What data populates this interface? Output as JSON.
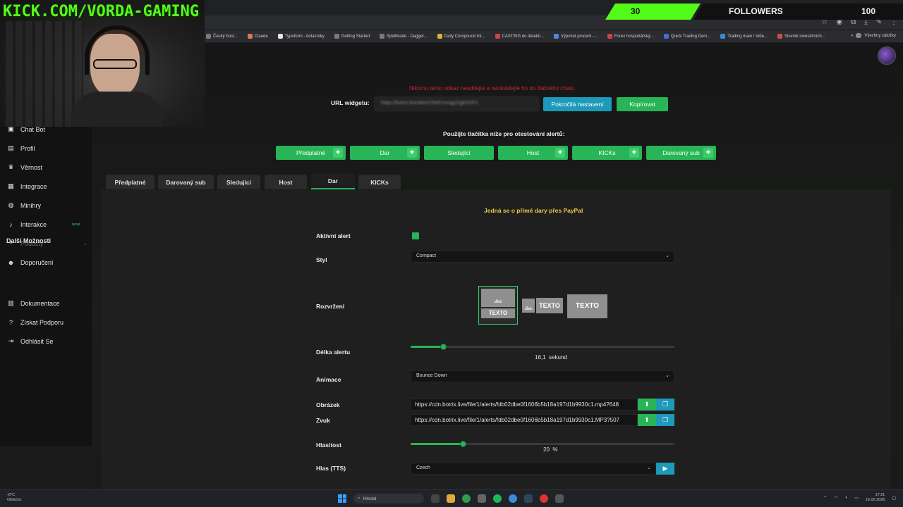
{
  "overlay": {
    "channel_title": "KICK.COM/VORDA-GAMING",
    "follower_count": "30",
    "follower_label": "FOLLOWERS",
    "follower_goal": "100"
  },
  "browser": {
    "bookmarks": [
      {
        "label": "Český host...",
        "icon": "globe-icon"
      },
      {
        "label": "Claude",
        "icon": "claude-icon"
      },
      {
        "label": "Typeform - dotazníky",
        "icon": "typeform-icon"
      },
      {
        "label": "Getting Started",
        "icon": "bookmark-icon"
      },
      {
        "label": "Spellblade - Dagger...",
        "icon": "bookmark-icon"
      },
      {
        "label": "Daily Compound Int...",
        "icon": "folder-icon"
      },
      {
        "label": "CASTING do detekti...",
        "icon": "bookmark-icon"
      },
      {
        "label": "Výpočet procent -...",
        "icon": "bookmark-icon"
      },
      {
        "label": "Forex hospodářský...",
        "icon": "bookmark-icon"
      },
      {
        "label": "Quick Trading Dem...",
        "icon": "bookmark-icon"
      },
      {
        "label": "Trading main / Vide...",
        "icon": "bookmark-icon"
      },
      {
        "label": "Slovník investičních...",
        "icon": "bookmark-icon"
      }
    ],
    "all_bookmarks": "Všechny záložky"
  },
  "sidebar": {
    "items": [
      {
        "label": "Chat Bot",
        "icon": "robot-icon"
      },
      {
        "label": "Profil",
        "icon": "id-card-icon"
      },
      {
        "label": "Věrnost",
        "icon": "trophy-icon"
      },
      {
        "label": "Integrace",
        "icon": "puzzle-icon"
      },
      {
        "label": "Minihry",
        "icon": "gamepad-icon"
      },
      {
        "label": "Interakce",
        "icon": "music-icon",
        "badge": "nové"
      },
      {
        "label": "Podúčty",
        "icon": "user-gear-icon"
      },
      {
        "label": "Doporučení",
        "icon": "users-icon"
      }
    ],
    "section_heading": "Další Možnosti",
    "more_items": [
      {
        "label": "Dokumentace",
        "icon": "book-icon"
      },
      {
        "label": "Získat Podporu",
        "icon": "question-icon"
      },
      {
        "label": "Odhlásit Se",
        "icon": "logout-icon"
      }
    ]
  },
  "widget": {
    "warning": "Nikomu tento odkaz nesdílejte a neukládejte ho do žádného chatu",
    "url_label": "URL widgetu:",
    "url_value": "https://botrix.live/alerts?bid=mvqg22gk%2F2",
    "advanced_button": "Pokročilá nastavení",
    "copy_button": "Kopírovat",
    "test_hint": "Použijte tlačítka níže pro otestování alertů:",
    "test_buttons": [
      "Předplatné",
      "Dar",
      "Sledující",
      "Host",
      "KICKs",
      "Darovaný sub"
    ]
  },
  "tabs": [
    "Předplatné",
    "Darovaný sub",
    "Sledující",
    "Host",
    "Dar",
    "KICKs"
  ],
  "active_tab": "Dar",
  "form": {
    "note": "Jedná se o přímé dary přes PayPal",
    "active_alert_label": "Aktivní alert",
    "active_alert": true,
    "style_label": "Styl",
    "style_value": "Compact",
    "layout_label": "Rozvržení",
    "layout_text": "TEXTO",
    "duration_label": "Délka alertu",
    "duration_fraction": 0.127,
    "duration_value": "16,1",
    "duration_unit": "sekund",
    "animation_label": "Animace",
    "animation_value": "Bounce Down",
    "image_label": "Obrázek",
    "image_value": "https://cdn.botrix.live/file/1/alerts/fdb02dbe0f1606b5b18a197d1b9930c1.mp4?648",
    "sound_label": "Zvuk",
    "sound_value": "https://cdn.botrix.live/file/1/alerts/fdb02dbe0f1606b5b18a197d1b9930c1.MP3?507",
    "volume_label": "Hlasitost",
    "volume_fraction": 0.2,
    "volume_value": "20",
    "volume_unit": "%",
    "voice_label": "Hlas (TTS)",
    "voice_value": "Czech"
  },
  "taskbar": {
    "weather_temp": "-8°C",
    "weather_desc": "Oblačno",
    "search_placeholder": "Hledat",
    "time": "17:21",
    "date": "16.02.2026"
  },
  "colors": {
    "kick_green": "#53fc18",
    "accent_green": "#28b557",
    "accent_blue": "#1d9ab9",
    "warning_red": "#c0283b",
    "note_yellow": "#e8c84a"
  }
}
